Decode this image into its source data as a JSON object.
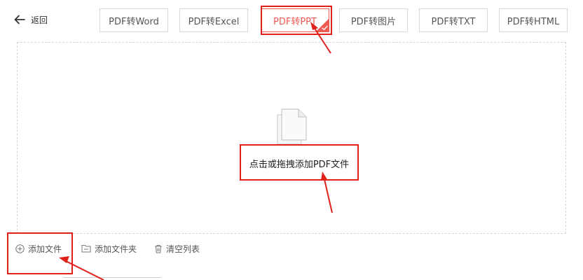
{
  "header": {
    "back_label": "返回",
    "tabs": [
      {
        "label": "PDF转Word",
        "active": false
      },
      {
        "label": "PDF转Excel",
        "active": false
      },
      {
        "label": "PDF转PPT",
        "active": true
      },
      {
        "label": "PDF转图片",
        "active": false
      },
      {
        "label": "PDF转TXT",
        "active": false
      },
      {
        "label": "PDF转HTML",
        "active": false
      }
    ]
  },
  "dropzone": {
    "prompt": "点击或拖拽添加PDF文件"
  },
  "actions": {
    "add_file": "添加文件",
    "add_folder": "添加文件夹",
    "clear_list": "清空列表"
  },
  "colors": {
    "accent": "#f05a50",
    "annotation": "#e0201a",
    "border": "#d9d9d9"
  }
}
